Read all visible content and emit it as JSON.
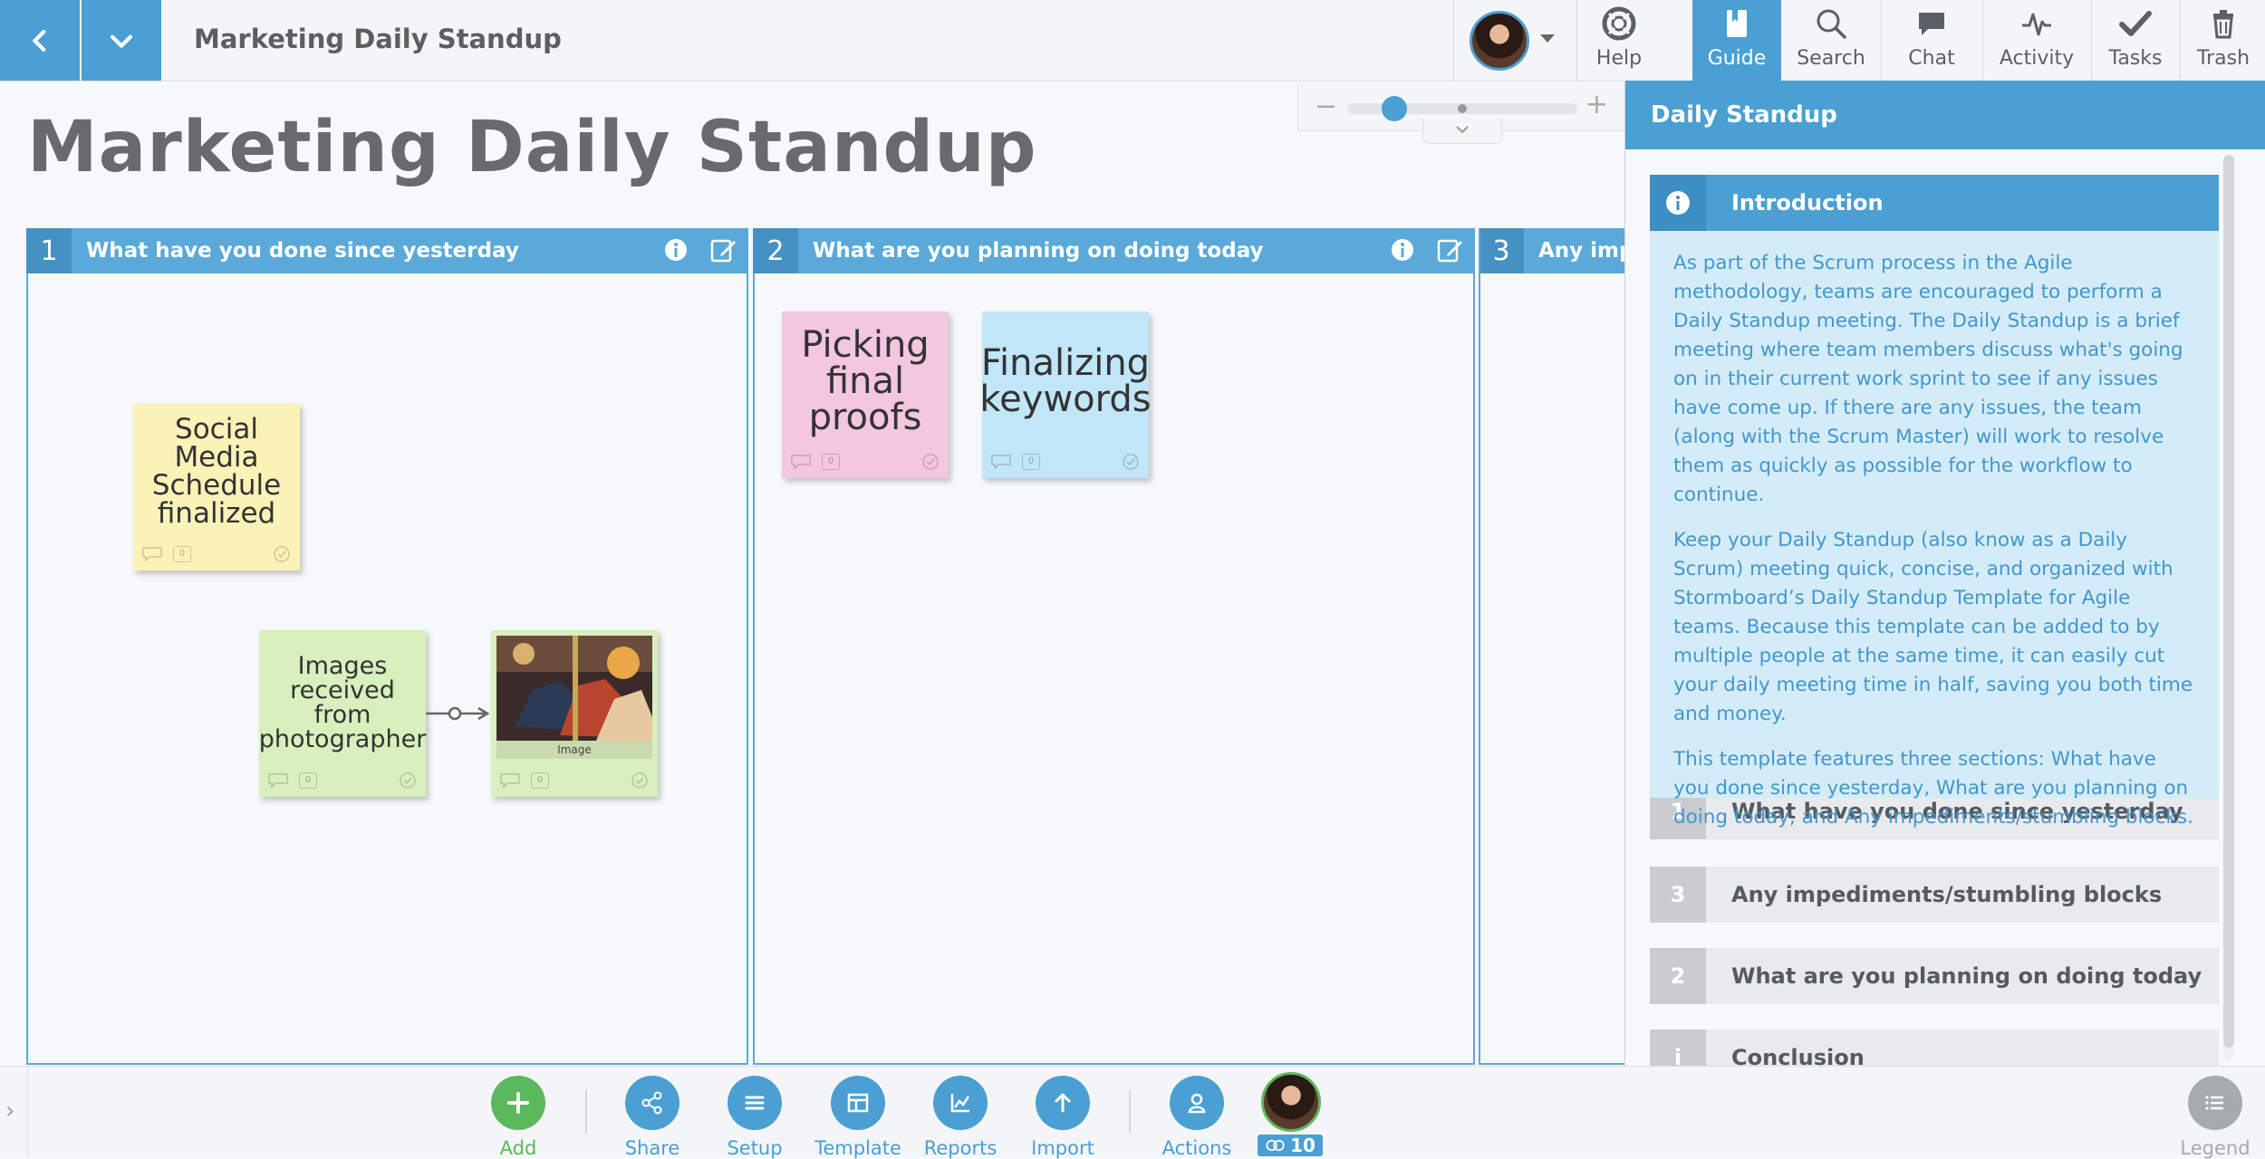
{
  "header": {
    "board_title": "Marketing Daily Standup",
    "tools": [
      {
        "label": "Help",
        "icon": "help-icon"
      },
      {
        "label": "Guide",
        "icon": "guide-icon",
        "active": true
      },
      {
        "label": "Search",
        "icon": "search-icon"
      },
      {
        "label": "Chat",
        "icon": "chat-icon"
      },
      {
        "label": "Activity",
        "icon": "activity-icon"
      },
      {
        "label": "Tasks",
        "icon": "tasks-icon"
      },
      {
        "label": "Trash",
        "icon": "trash-icon"
      }
    ]
  },
  "zoom": {
    "minus": "−",
    "plus": "+"
  },
  "board": {
    "title": "Marketing Daily Standup",
    "sections": [
      {
        "number": "1",
        "title": "What have you done since yesterday"
      },
      {
        "number": "2",
        "title": "What are you planning on doing today"
      },
      {
        "number": "3",
        "title": "Any impediments/stumbling blocks"
      }
    ],
    "notes": [
      {
        "text": "Social Media Schedule finalized",
        "color": "yellow",
        "comments": "0"
      },
      {
        "text": "Images received from photographer",
        "color": "green",
        "comments": "0"
      },
      {
        "caption": "Image",
        "color": "green",
        "comments": "0"
      },
      {
        "text": "Picking final proofs",
        "color": "pink",
        "comments": "0"
      },
      {
        "text": "Finalizing keywords",
        "color": "blue",
        "comments": "0"
      }
    ]
  },
  "guide": {
    "title": "Daily Standup",
    "active_section": "Introduction",
    "intro_paragraphs": [
      "As part of the Scrum process in the Agile methodology, teams are encouraged to perform a Daily Standup meeting. The Daily Standup is a brief meeting where team members discuss what's going on in their current work sprint to see if any issues have come up. If there are any issues, the team (along with the Scrum Master) will work to resolve them as quickly as possible for the workflow to continue.",
      "Keep your Daily Standup (also know as a Daily Scrum) meeting quick, concise, and organized with Stormboard’s Daily Standup Template for Agile teams. Because this template can be added to by multiple people at the same time, it can easily cut your daily meeting time in half, saving you both time and money.",
      " This template features three sections: What have you done since yesterday, What are you planning on doing today, and Any impediments/stumbling blocks."
    ],
    "items": [
      {
        "number": "1",
        "label": "What have you done since yesterday"
      },
      {
        "number": "3",
        "label": "Any impediments/stumbling blocks"
      },
      {
        "number": "2",
        "label": "What are you planning on doing today"
      },
      {
        "number": "i",
        "label": "Conclusion"
      }
    ]
  },
  "bottombar": {
    "buttons": [
      {
        "label": "Add",
        "icon": "plus-icon",
        "color": "#5cb85c"
      },
      {
        "label": "Share",
        "icon": "share-icon"
      },
      {
        "label": "Setup",
        "icon": "setup-icon"
      },
      {
        "label": "Template",
        "icon": "template-icon"
      },
      {
        "label": "Reports",
        "icon": "reports-icon"
      },
      {
        "label": "Import",
        "icon": "import-icon"
      },
      {
        "label": "Actions",
        "icon": "actions-icon"
      }
    ],
    "user_count": "10",
    "legend": "Legend"
  },
  "colors": {
    "accent": "#4a9fd3",
    "add": "#5cb85c"
  }
}
